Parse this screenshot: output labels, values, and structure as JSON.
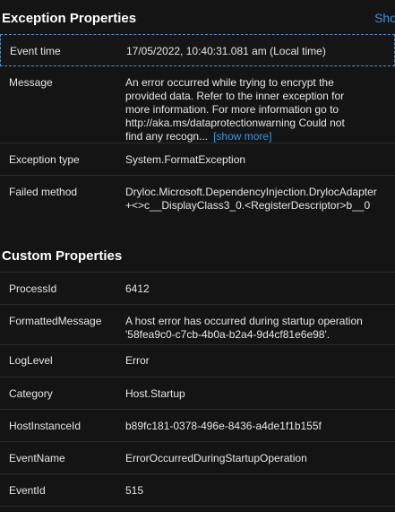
{
  "exception": {
    "title": "Exception Properties",
    "show_link": "Sho",
    "rows": [
      {
        "key": "Event time",
        "value": "17/05/2022, 10:40:31.081 am (Local time)"
      },
      {
        "key": "Message",
        "value": "An error occurred while trying to encrypt the provided data. Refer to the inner exception for more information. For more information go to http://aka.ms/dataprotectionwarning Could not find any recogn...",
        "more": "[show more]"
      },
      {
        "key": "Exception type",
        "value": "System.FormatException"
      },
      {
        "key": "Failed method",
        "value": "Dryloc.Microsoft.DependencyInjection.DrylocAdapter+<>c__DisplayClass3_0.<RegisterDescriptor>b__0"
      }
    ]
  },
  "custom": {
    "title": "Custom Properties",
    "rows": [
      {
        "key": "ProcessId",
        "value": "6412"
      },
      {
        "key": "FormattedMessage",
        "value": "A host error has occurred during startup operation '58fea9c0-c7cb-4b0a-b2a4-9d4cf81e6e98'."
      },
      {
        "key": "LogLevel",
        "value": "Error"
      },
      {
        "key": "Category",
        "value": "Host.Startup"
      },
      {
        "key": "HostInstanceId",
        "value": "b89fc181-0378-496e-8436-a4de1f1b155f"
      },
      {
        "key": "EventName",
        "value": "ErrorOccurredDuringStartupOperation"
      },
      {
        "key": "EventId",
        "value": "515"
      }
    ]
  }
}
